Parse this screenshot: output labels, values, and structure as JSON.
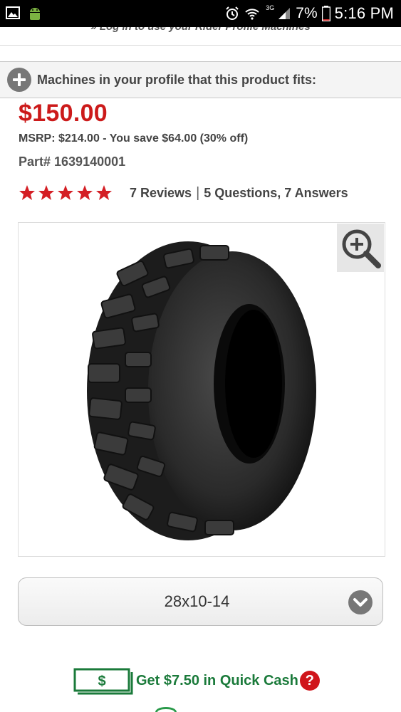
{
  "status_bar": {
    "time": "5:16 PM",
    "battery": "7%",
    "network": "3G",
    "icons": [
      "gallery-icon",
      "android-icon",
      "alarm-icon",
      "wifi-icon",
      "signal-icon",
      "battery-icon"
    ]
  },
  "login_prompt": "» Log in to use your Rider Profile Machines",
  "machines_bar": {
    "label": "Machines in your profile that this product fits:",
    "icon": "plus-circle-icon"
  },
  "product": {
    "price": "$150.00",
    "msrp_line": "MSRP: $214.00 - You save $64.00 (30% off)",
    "part_line": "Part# 1639140001",
    "rating": 5,
    "rating_max": 5,
    "reviews_label": "7 Reviews",
    "separator": "|",
    "qa_label": "5 Questions, 7 Answers",
    "image_alt": "tire-image",
    "zoom_icon": "magnifier-plus-icon"
  },
  "size_select": {
    "selected": "28x10-14",
    "icon": "chevron-down-icon"
  },
  "quick_cash": {
    "label": "Get $7.50 in Quick Cash",
    "badge_symbol": "$",
    "help_symbol": "?"
  },
  "colors": {
    "price_red": "#cc1a1a",
    "star_red": "#d41e24",
    "cash_green": "#1a7a3a",
    "help_red": "#d0151b"
  }
}
